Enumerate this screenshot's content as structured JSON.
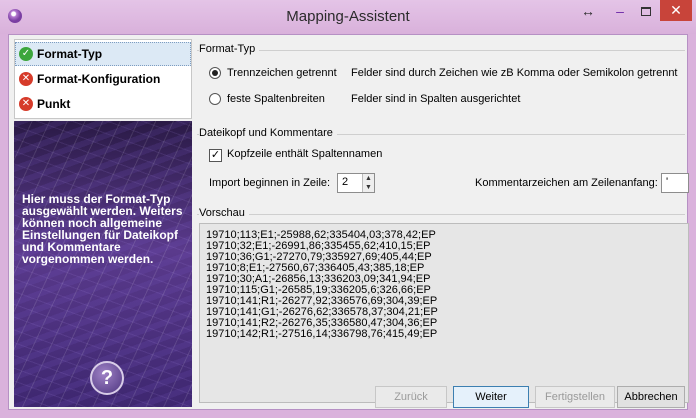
{
  "window": {
    "title": "Mapping-Assistent",
    "restore_glyph": "↔",
    "minimize_glyph": "–",
    "close_glyph": "✕",
    "icon": "app-icon"
  },
  "steps": [
    {
      "label": "Format-Typ",
      "state": "ok",
      "icon_glyph": "✓"
    },
    {
      "label": "Format-Konfiguration",
      "state": "error",
      "icon_glyph": "✕"
    },
    {
      "label": "Punkt",
      "state": "error",
      "icon_glyph": "✕"
    }
  ],
  "sidepanel": {
    "text": "Hier muss der Format-Typ ausgewählt werden. Weiters können noch allgemeine Einstellungen für Dateikopf und Kommentare vorgenommen werden.",
    "help_glyph": "?"
  },
  "format_type": {
    "group_title": "Format-Typ",
    "options": [
      {
        "label": "Trennzeichen getrennt",
        "description": "Felder sind durch Zeichen wie zB Komma oder Semikolon getrennt",
        "checked": true
      },
      {
        "label": "feste Spaltenbreiten",
        "description": "Felder sind in Spalten ausgerichtet",
        "checked": false
      }
    ]
  },
  "header_section": {
    "group_title": "Dateikopf und Kommentare",
    "checkbox_label": "Kopfzeile enthält Spaltennamen",
    "checkbox_checked": true,
    "import_label": "Import beginnen in Zeile:",
    "import_value": "2",
    "comment_label": "Kommentarzeichen am Zeilenanfang:",
    "comment_value": "'"
  },
  "preview": {
    "group_title": "Vorschau",
    "lines": [
      "19710;113;E1;-25988,62;335404,03;378,42;EP",
      "19710;32;E1;-26991,86;335455,62;410,15;EP",
      "19710;36;G1;-27270,79;335927,69;405,44;EP",
      "19710;8;E1;-27560,67;336405,43;385,18;EP",
      "19710;30;A1;-26856,13;336203,09;341,94;EP",
      "19710;115;G1;-26585,19;336205,6;326,66;EP",
      "19710;141;R1;-26277,92;336576,69;304,39;EP",
      "19710;141;G1;-26276,62;336578,37;304,21;EP",
      "19710;141;R2;-26276,35;336580,47;304,36;EP",
      "19710;142;R1;-27516,14;336798,76;415,49;EP"
    ]
  },
  "buttons": {
    "back": "Zurück",
    "next": "Weiter",
    "finish": "Fertigstellen",
    "cancel": "Abbrechen"
  }
}
